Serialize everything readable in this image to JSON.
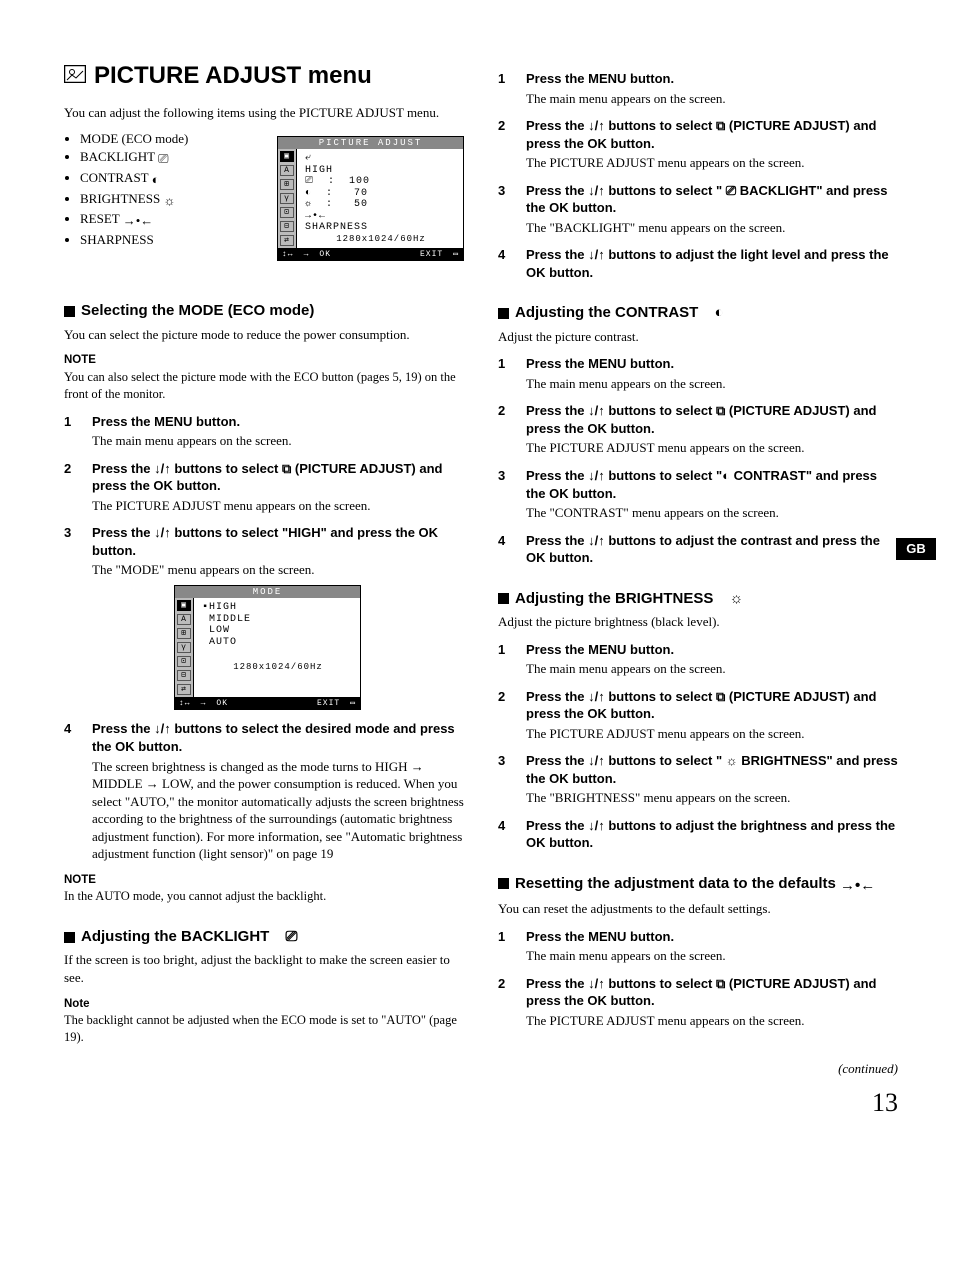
{
  "tab": "GB",
  "page_number": "13",
  "continued": "(continued)",
  "title": "PICTURE ADJUST menu",
  "intro": "You can adjust the following items using the PICTURE ADJUST menu.",
  "items": [
    "MODE (ECO mode)",
    "BACKLIGHT",
    "CONTRAST",
    "BRIGHTNESS",
    "RESET",
    "SHARPNESS"
  ],
  "osd1": {
    "title": "PICTURE ADJUST",
    "rows": [
      "HIGH",
      "100",
      "70",
      "50"
    ],
    "sharp": "SHARPNESS",
    "res": "1280x1024/60Hz",
    "footer_ok": "OK",
    "footer_exit": "EXIT"
  },
  "sec_mode": {
    "heading": "Selecting the MODE (ECO mode)",
    "desc": "You can select the picture mode to reduce the power consumption.",
    "note_hd": "NOTE",
    "note": "You can also select the picture mode with the ECO button (pages 5, 19) on the front of the monitor."
  },
  "mode_steps": [
    {
      "n": "1",
      "head": "Press the MENU button.",
      "desc": "The main menu appears on the screen."
    },
    {
      "n": "2",
      "head": "Press the ↓/↑ buttons to select  ⧉ (PICTURE ADJUST) and press the OK button.",
      "desc": "The PICTURE ADJUST menu appears on the screen."
    },
    {
      "n": "3",
      "head": "Press the ↓/↑ buttons to select \"HIGH\" and press the OK button.",
      "desc": "The \"MODE\" menu appears on the screen."
    },
    {
      "n": "4",
      "head": "Press the ↓/↑ buttons to select the desired mode and press the OK button.",
      "desc": "The screen brightness is changed as the mode turns to HIGH → MIDDLE → LOW, and the power consumption is reduced. When you select \"AUTO,\" the monitor automatically adjusts the screen brightness according to the brightness of the surroundings (automatic brightness adjustment function). For more information, see \"Automatic brightness adjustment function (light sensor)\" on page 19"
    }
  ],
  "osd2": {
    "title": "MODE",
    "opts": [
      "HIGH",
      "MIDDLE",
      "LOW",
      "AUTO"
    ],
    "res": "1280x1024/60Hz",
    "footer_ok": "OK",
    "footer_exit": "EXIT"
  },
  "mode_note2_hd": "NOTE",
  "mode_note2": "In the AUTO mode, you cannot adjust the backlight.",
  "sec_backlight": {
    "heading": "Adjusting the BACKLIGHT",
    "desc": "If the screen is too bright, adjust the backlight to make the screen easier to see.",
    "note_hd": "Note",
    "note": "The backlight cannot be adjusted when the ECO mode is set to \"AUTO\" (page 19)."
  },
  "bl_steps": [
    {
      "n": "1",
      "head": "Press the MENU button.",
      "desc": "The main menu appears on the screen."
    },
    {
      "n": "2",
      "head": "Press the ↓/↑ buttons to select  ⧉ (PICTURE ADJUST) and press the OK button.",
      "desc": "The PICTURE ADJUST menu appears on the screen."
    },
    {
      "n": "3",
      "head": "Press the ↓/↑ buttons to select \" ⎚ BACKLIGHT\" and press the OK button.",
      "desc": "The \"BACKLIGHT\" menu appears on the screen."
    },
    {
      "n": "4",
      "head": "Press the ↓/↑ buttons to adjust the light level and press the OK button.",
      "desc": ""
    }
  ],
  "sec_contrast": {
    "heading": "Adjusting the CONTRAST",
    "desc": "Adjust the picture contrast."
  },
  "ct_steps": [
    {
      "n": "1",
      "head": "Press the MENU button.",
      "desc": "The main menu appears on the screen."
    },
    {
      "n": "2",
      "head": "Press the ↓/↑ buttons to select  ⧉ (PICTURE ADJUST) and press the OK button.",
      "desc": "The PICTURE ADJUST menu appears on the screen."
    },
    {
      "n": "3",
      "head": "Press the ↓/↑ buttons to select \"◐ CONTRAST\" and press the OK button.",
      "desc": "The \"CONTRAST\" menu appears on the screen."
    },
    {
      "n": "4",
      "head": "Press the ↓/↑ buttons to adjust the contrast and press the OK button.",
      "desc": ""
    }
  ],
  "sec_bright": {
    "heading": "Adjusting the BRIGHTNESS",
    "desc": "Adjust the picture brightness (black level)."
  },
  "br_steps": [
    {
      "n": "1",
      "head": "Press the MENU button.",
      "desc": "The main menu appears on the screen."
    },
    {
      "n": "2",
      "head": "Press the ↓/↑ buttons to select  ⧉ (PICTURE ADJUST) and press the OK button.",
      "desc": "The PICTURE ADJUST menu appears on the screen."
    },
    {
      "n": "3",
      "head": "Press the ↓/↑ buttons to select \" ☼ BRIGHTNESS\" and press the OK button.",
      "desc": "The \"BRIGHTNESS\" menu appears on the screen."
    },
    {
      "n": "4",
      "head": "Press the ↓/↑ buttons to adjust the brightness and press the OK button.",
      "desc": ""
    }
  ],
  "sec_reset": {
    "heading": "Resetting the adjustment data to the defaults",
    "desc": "You can reset the adjustments to the default settings."
  },
  "rs_steps": [
    {
      "n": "1",
      "head": "Press the MENU button.",
      "desc": "The main menu appears on the screen."
    },
    {
      "n": "2",
      "head": "Press the ↓/↑ buttons to select  ⧉ (PICTURE ADJUST) and press the OK button.",
      "desc": "The PICTURE ADJUST menu appears on the screen."
    }
  ]
}
